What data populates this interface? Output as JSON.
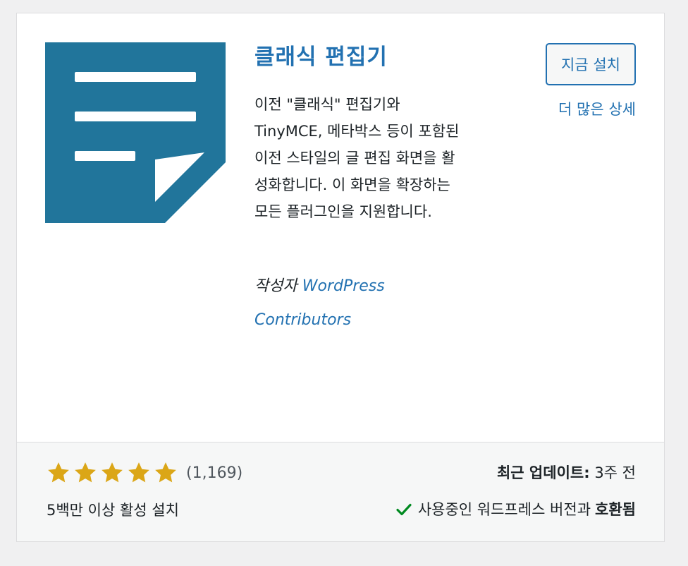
{
  "plugin": {
    "title": "클래식 편집기",
    "description": "이전 \"클래식\" 편집기와 TinyMCE, 메타박스 등이 포함된 이전 스타일의 글 편집 화면을 활성화합니다. 이 화면을 확장하는 모든 플러그인을 지원합니다.",
    "author_prefix": "작성자",
    "author_name": "WordPress Contributors",
    "icon": "document-icon",
    "icon_color": "#21759b"
  },
  "actions": {
    "install_label": "지금 설치",
    "more_details_label": "더 많은 상세"
  },
  "footer": {
    "rating_stars": 5,
    "rating_max": 5,
    "rating_count": "(1,169)",
    "star_color": "#dba617",
    "active_installs": "5백만 이상 활성 설치",
    "last_updated_label": "최근 업데이트:",
    "last_updated_value": "3주 전",
    "compat_text": "사용중인 워드프레스 버전과",
    "compat_status": "호환됨",
    "compat_color": "#008a20"
  }
}
